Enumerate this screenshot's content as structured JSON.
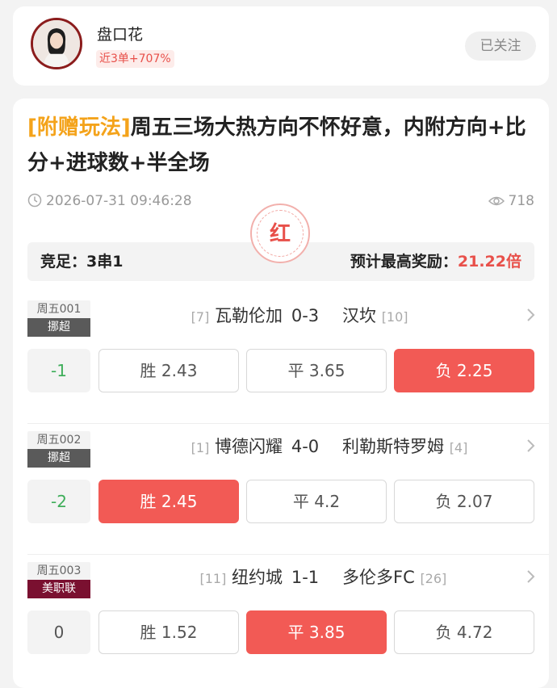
{
  "profile": {
    "name": "盘口花",
    "record": "近3单+707%",
    "follow_label": "已关注"
  },
  "article": {
    "title_tag": "[附赠玩法]",
    "title_text": "周五三场大热方向不怀好意，内附方向+比分+进球数+半全场",
    "datetime": "2026-07-31 09:46:28",
    "views": "718",
    "stamp": "红"
  },
  "summary": {
    "type_label": "竞足：3串1",
    "reward_label": "预计最高奖励：",
    "reward_value": "21.22倍"
  },
  "colors": {
    "accent_red": "#f25a55",
    "tag_orange": "#f4a31b",
    "handicap_green": "#3fae5a"
  },
  "matches": [
    {
      "code": "周五001",
      "league": "挪超",
      "league_color": "#5a5a5a",
      "home_rank": "[7]",
      "home": "瓦勒伦加",
      "score": "0-3",
      "away": "汉坎",
      "away_rank": "[10]",
      "handicap": "-1",
      "handicap_style": "green",
      "win": "胜 2.43",
      "draw": "平 3.65",
      "lose": "负 2.25",
      "selected": "lose"
    },
    {
      "code": "周五002",
      "league": "挪超",
      "league_color": "#5a5a5a",
      "home_rank": "[1]",
      "home": "博德闪耀",
      "score": "4-0",
      "away": "利勒斯特罗姆",
      "away_rank": "[4]",
      "handicap": "-2",
      "handicap_style": "green",
      "win": "胜 2.45",
      "draw": "平 4.2",
      "lose": "负 2.07",
      "selected": "win"
    },
    {
      "code": "周五003",
      "league": "美职联",
      "league_color": "#7a1030",
      "home_rank": "[11]",
      "home": "纽约城",
      "score": "1-1",
      "away": "多伦多FC",
      "away_rank": "[26]",
      "handicap": "0",
      "handicap_style": "gray",
      "win": "胜 1.52",
      "draw": "平 3.85",
      "lose": "负 4.72",
      "selected": "draw"
    }
  ]
}
